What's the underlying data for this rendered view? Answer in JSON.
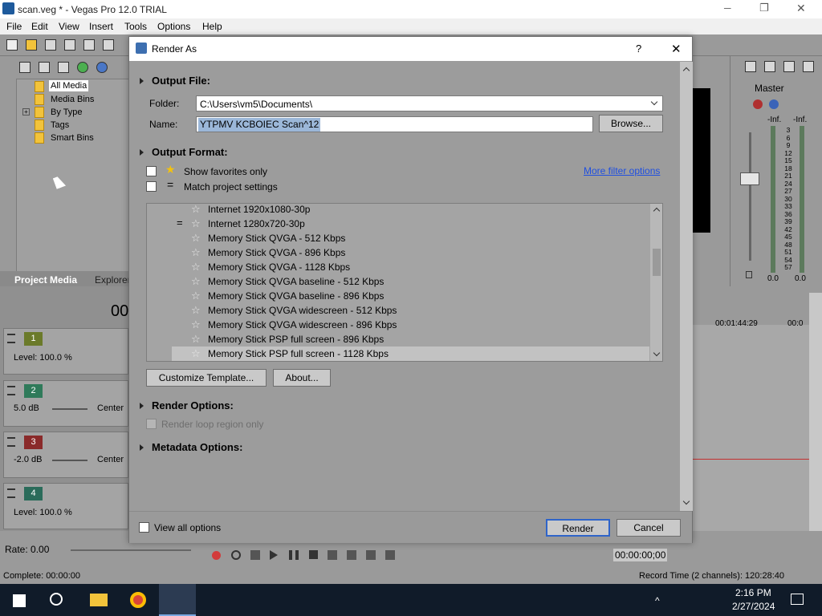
{
  "app": {
    "title": "scan.veg * - Vegas Pro 12.0 TRIAL",
    "menu": [
      "File",
      "Edit",
      "View",
      "Insert",
      "Tools",
      "Options",
      "Help"
    ],
    "window_controls": [
      "─",
      "❐",
      "✕"
    ]
  },
  "media_tree": {
    "items": [
      "All Media",
      "Media Bins",
      "By Type",
      "Tags",
      "Smart Bins"
    ],
    "tabs": [
      "Project Media",
      "Explorer"
    ]
  },
  "tracks": [
    {
      "num": "1",
      "color": "#6b7a2a",
      "info": "Level: 100.0 %"
    },
    {
      "num": "2",
      "color": "#2f7a5a",
      "db": "5.0 dB",
      "pan": "Center"
    },
    {
      "num": "3",
      "color": "#8a2a2a",
      "db": "-2.0 dB",
      "pan": "Center"
    },
    {
      "num": "4",
      "color": "#2a6b5a",
      "info": "Level: 100.0 %"
    }
  ],
  "timecode_fragment": "00",
  "mixer": {
    "label": "Master",
    "left_peak": "-Inf.",
    "right_peak": "-Inf.",
    "scale": [
      "3",
      "6",
      "9",
      "12",
      "15",
      "18",
      "21",
      "24",
      "27",
      "30",
      "33",
      "36",
      "39",
      "42",
      "45",
      "48",
      "51",
      "54",
      "57"
    ],
    "left_val": "0.0",
    "right_val": "0.0"
  },
  "timeline": {
    "marker1": "00:01:44:29",
    "marker2": "00:0"
  },
  "transport": {
    "rate": "Rate: 0.00",
    "timecode": "00:00:00;00"
  },
  "status": {
    "complete": "Complete: 00:00:00",
    "record_time": "Record Time (2 channels): 120:28:40"
  },
  "taskbar": {
    "time": "2:16 PM",
    "date": "2/27/2024"
  },
  "dialog": {
    "title": "Render As",
    "help": "?",
    "close": "✕",
    "output_file": {
      "heading": "Output File:",
      "folder_label": "Folder:",
      "folder_value": "C:\\Users\\vm5\\Documents\\",
      "name_label": "Name:",
      "name_value": "YTPMV KCBOIEC Scan^12",
      "browse": "Browse..."
    },
    "output_format": {
      "heading": "Output Format:",
      "show_favorites": "Show favorites only",
      "match_project": "Match project settings",
      "more_filter": "More filter options",
      "templates": [
        "Internet 1920x1080-30p",
        "Internet 1280x720-30p",
        "Memory Stick QVGA - 512 Kbps",
        "Memory Stick QVGA - 896 Kbps",
        "Memory Stick QVGA - 1128 Kbps",
        "Memory Stick QVGA baseline - 512 Kbps",
        "Memory Stick QVGA baseline - 896 Kbps",
        "Memory Stick QVGA widescreen - 512 Kbps",
        "Memory Stick QVGA widescreen - 896 Kbps",
        "Memory Stick PSP full screen - 896 Kbps",
        "Memory Stick PSP full screen - 1128 Kbps"
      ],
      "customize": "Customize Template...",
      "about": "About..."
    },
    "render_options": {
      "heading": "Render Options:",
      "loop_region": "Render loop region only"
    },
    "metadata_options": {
      "heading": "Metadata Options:"
    },
    "footer": {
      "view_all": "View all options",
      "render": "Render",
      "cancel": "Cancel"
    }
  }
}
